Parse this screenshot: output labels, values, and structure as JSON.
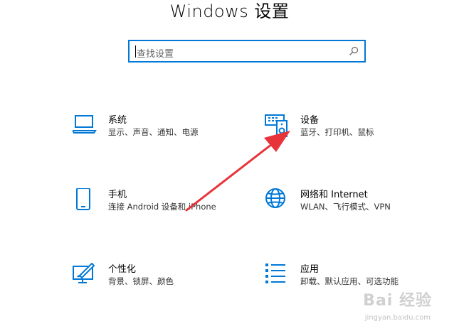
{
  "window": {
    "title": "Windows 设置"
  },
  "search": {
    "placeholder": "查找设置"
  },
  "tiles": [
    {
      "name": "系统",
      "desc": "显示、声音、通知、电源",
      "icon": "laptop-icon"
    },
    {
      "name": "设备",
      "desc": "蓝牙、打印机、鼠标",
      "icon": "devices-icon"
    },
    {
      "name": "手机",
      "desc": "连接 Android 设备和 iPhone",
      "icon": "phone-icon"
    },
    {
      "name": "网络和 Internet",
      "desc": "WLAN、飞行模式、VPN",
      "icon": "globe-icon"
    },
    {
      "name": "个性化",
      "desc": "背景、锁屏、颜色",
      "icon": "personalize-icon"
    },
    {
      "name": "应用",
      "desc": "卸载、默认应用、可选功能",
      "icon": "apps-icon"
    }
  ],
  "watermark": {
    "text": "Bai 经验",
    "sub": "jingyan.baidu.com"
  },
  "colors": {
    "accent": "#0078d7",
    "arrow": "#e8333a"
  }
}
